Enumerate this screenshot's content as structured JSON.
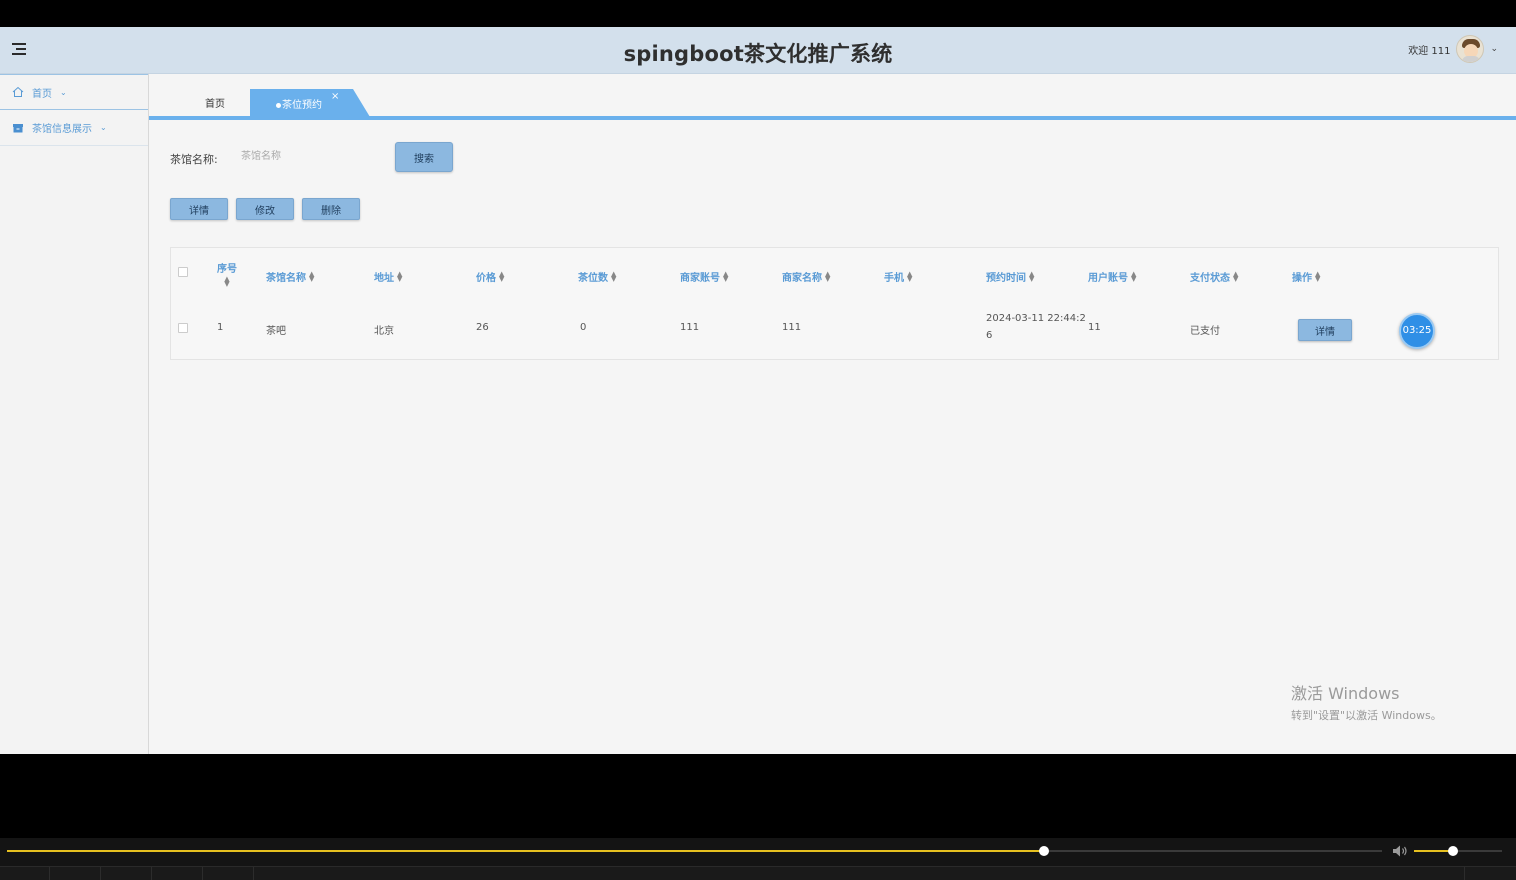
{
  "header": {
    "title": "spingboot茶文化推广系统",
    "welcome": "欢迎 111",
    "icons": {
      "menu": "menu-toggle-icon",
      "avatar": "user-avatar",
      "caret": "chevron-down-icon"
    }
  },
  "sidebar": {
    "items": [
      {
        "label": "首页",
        "icon": "home-icon"
      },
      {
        "label": "茶馆信息展示",
        "icon": "archive-icon"
      }
    ]
  },
  "tabs": {
    "home": "首页",
    "active": "茶位预约",
    "close": "×"
  },
  "search": {
    "label": "茶馆名称:",
    "placeholder": "茶馆名称",
    "value": "",
    "button": "搜索"
  },
  "actions": {
    "detail": "详情",
    "edit": "修改",
    "delete": "删除"
  },
  "table": {
    "columns": [
      "序号",
      "茶馆名称",
      "地址",
      "价格",
      "茶位数",
      "商家账号",
      "商家名称",
      "手机",
      "预约时间",
      "用户账号",
      "支付状态",
      "操作"
    ],
    "rows": [
      {
        "index": "1",
        "name": "茶吧",
        "address": "北京",
        "price": "26",
        "seats": "0",
        "merchant_account": "111",
        "merchant_name": "111",
        "phone": "",
        "time_line1": "2024-03-11 22:44:2",
        "time_line2": "6",
        "user_account": "11",
        "pay_status": "已支付",
        "op": "详情"
      }
    ]
  },
  "timer": "03:25",
  "watermark": {
    "line1": "激活 Windows",
    "line2": "转到\"设置\"以激活 Windows。"
  },
  "player": {
    "progress": 0.754,
    "volume": 0.44,
    "accent": "#e6c020"
  }
}
